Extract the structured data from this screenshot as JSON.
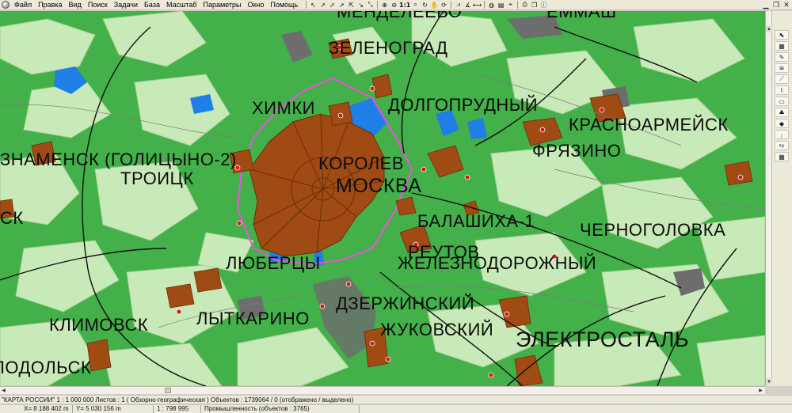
{
  "menu": {
    "items": [
      "Файл",
      "Правка",
      "Вид",
      "Поиск",
      "Задачи",
      "База",
      "Масштаб",
      "Параметры",
      "Окно",
      "Помощь"
    ]
  },
  "toolbar": {
    "scale_label": "1:1",
    "buttons": [
      "select-icon",
      "pointer-icon",
      "zoom-in-icon",
      "zoom-out-icon",
      "hand-icon",
      "measure-icon",
      "layers-icon",
      "print-icon",
      "help-icon"
    ]
  },
  "map": {
    "labels": {
      "mendeleevo": "МЕНДЕЛЕЕВО",
      "zelenograd": "ЗЕЛЕНОГРАД",
      "khimki": "ХИМКИ",
      "dolgoprudny": "ДОЛГОПРУДНЫЙ",
      "krasnoarmeysk": "КРАСНОАРМЕЙСК",
      "fryazino": "ФРЯЗИНО",
      "znamensk": "ЗНАМЕНСК (ГОЛИЦЫНО-2)",
      "korolev": "КОРОЛЕВ",
      "moskva": "МОСКВА",
      "troitsk": "ТРОИЦК",
      "balashikha": "БАЛАШИХА-1",
      "chernogolovka": "ЧЕРНОГОЛОВКА",
      "reutov": "РЕУТОВ",
      "zheleznodorozhny": "ЖЕЛЕЗНОДОРОЖНЫЙ",
      "lyubertsy": "ЛЮБЕРЦЫ",
      "dzerzhinsky": "ДЗЕРЖИНСКИЙ",
      "lytkarino": "ЛЫТКАРИНО",
      "klimovsk": "КЛИМОВСК",
      "zhukovsky": "ЖУКОВСКИЙ",
      "elektrostal": "ЭЛЕКТРОСТАЛЬ",
      "podolsk": "ПОДОЛЬСК",
      "yemash": "ЕММАШ",
      "partial_left": "СК"
    },
    "colors": {
      "meadow": "#43b04a",
      "forest": "#c8e9b8",
      "city": "#a14b14",
      "industrial": "#6d6d6d",
      "water": "#1f7fe6",
      "boundary": "#ef4fe2"
    }
  },
  "status": {
    "line1": "\"КАРТА РОССИИ\"  1 : 1 000 000   Листов : 1   ( Обзорно-географическая )  Объектов : 1739064 / 0 (отображено / выделено)",
    "x_coord": "X=  8 188 402 m",
    "y_coord": "Y=  5 030 156 m",
    "scale": "1 : 798 995",
    "layer": "Промышленность   (объектов : 3765)"
  }
}
